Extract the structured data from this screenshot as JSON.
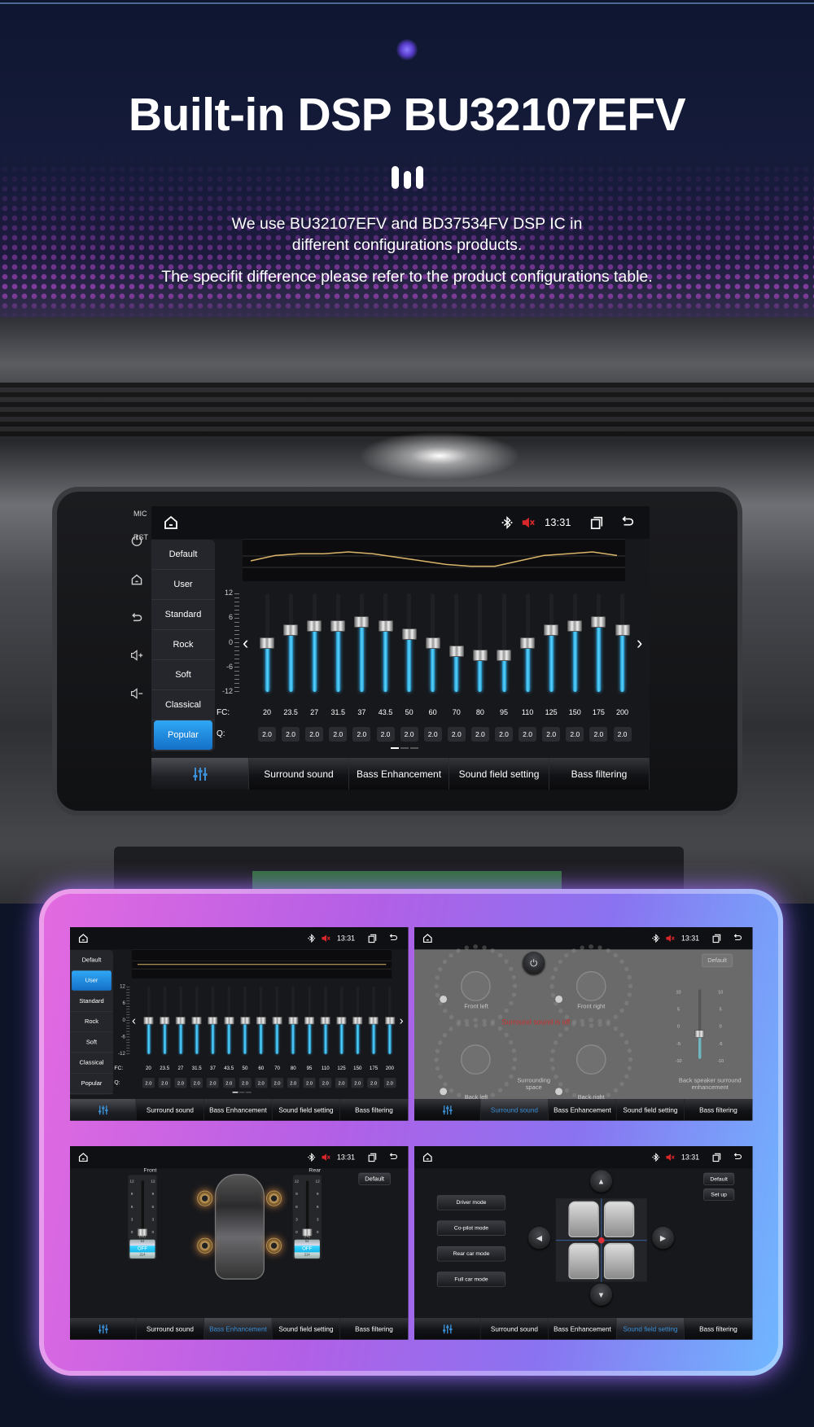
{
  "header": {
    "title": "Built-in DSP BU32107EFV",
    "line1": "We use BU32107EFV and BD37534FV DSP IC in",
    "line2": "different configurations products.",
    "line3": "The specifit difference please refer to the product configurations table."
  },
  "colors": {
    "accent_blue": "#2fa7f5",
    "slider_fill": "#59d6ff",
    "mute_red": "#d8262a",
    "curve": "#d9b56a",
    "active_tab": "#3a8fd6",
    "frame_left": "#e060e0",
    "frame_right": "#5fb0ff"
  },
  "side_panel": {
    "mic": "MIC",
    "rst": "RST",
    "icons": [
      "power-icon",
      "home-icon",
      "back-icon",
      "volume-up-icon",
      "volume-down-icon"
    ]
  },
  "status_bar": {
    "time": "13:31",
    "icons": [
      "home-icon",
      "bluetooth-icon",
      "mute-icon",
      "recent-apps-icon",
      "back-icon"
    ]
  },
  "tabs": {
    "eq_icon": "equalizer-icon",
    "items": [
      "Surround sound",
      "Bass Enhancement",
      "Sound field setting",
      "Bass filtering"
    ]
  },
  "eq_main": {
    "presets": [
      "Default",
      "User",
      "Standard",
      "Rock",
      "Soft",
      "Classical",
      "Popular"
    ],
    "selected": "Popular",
    "y_ticks": [
      "12",
      "6",
      "0",
      "-6",
      "-12"
    ],
    "gain_range": [
      -12,
      12
    ],
    "fc_label": "FC:",
    "q_label": "Q:",
    "fc": [
      "20",
      "23.5",
      "27",
      "31.5",
      "37",
      "43.5",
      "50",
      "60",
      "70",
      "80",
      "95",
      "110",
      "125",
      "150",
      "175",
      "200"
    ],
    "q": [
      "2.0",
      "2.0",
      "2.0",
      "2.0",
      "2.0",
      "2.0",
      "2.0",
      "2.0",
      "2.0",
      "2.0",
      "2.0",
      "2.0",
      "2.0",
      "2.0",
      "2.0",
      "2.0"
    ],
    "gains": [
      0,
      3,
      4,
      4,
      5,
      4,
      2,
      0,
      -2,
      -3,
      -3,
      0,
      3,
      4,
      5,
      3
    ],
    "page": 1,
    "pages": 3
  },
  "eq_mini": {
    "presets": [
      "Default",
      "User",
      "Standard",
      "Rock",
      "Soft",
      "Classical",
      "Popular"
    ],
    "selected": "User",
    "y_ticks": [
      "12",
      "6",
      "0",
      "-6",
      "-12"
    ],
    "fc_label": "FC:",
    "q_label": "Q:",
    "fc": [
      "20",
      "23.5",
      "27",
      "31.5",
      "37",
      "43.5",
      "50",
      "60",
      "70",
      "80",
      "95",
      "110",
      "125",
      "150",
      "175",
      "200"
    ],
    "q": [
      "2.0",
      "2.0",
      "2.0",
      "2.0",
      "2.0",
      "2.0",
      "2.0",
      "2.0",
      "2.0",
      "2.0",
      "2.0",
      "2.0",
      "2.0",
      "2.0",
      "2.0",
      "2.0"
    ],
    "gains": [
      0,
      0,
      0,
      0,
      0,
      0,
      0,
      0,
      0,
      0,
      0,
      0,
      0,
      0,
      0,
      0
    ],
    "page": 1,
    "pages": 3
  },
  "surround": {
    "active_tab": "Surround sound",
    "default_label": "Default",
    "front_left": "Front left",
    "front_right": "Front right",
    "back_left": "Back left",
    "back_right": "Back right",
    "space": "Surrounding space",
    "back_speaker": "Back speaker surround enhancement",
    "off_message": "Surround sound is off",
    "ticks": [
      "10",
      "5",
      "0",
      "-5",
      "-10"
    ],
    "level": -3
  },
  "bass": {
    "active_tab": "Bass Enhancement",
    "default_label": "Default",
    "channels": [
      {
        "label": "Front",
        "ticks": [
          "12",
          "9",
          "6",
          "3",
          "0"
        ],
        "unit": "(Hz)",
        "freq_above": "54",
        "freq_value": "OFF",
        "freq_below": "214",
        "level": 0
      },
      {
        "label": "Rear",
        "ticks": [
          "12",
          "9",
          "6",
          "3",
          "0"
        ],
        "unit": "(Hz)",
        "freq_above": "54",
        "freq_value": "OFF",
        "freq_below": "214",
        "level": 0
      }
    ]
  },
  "sound_field": {
    "active_tab": "Sound field setting",
    "modes": [
      "Driver mode",
      "Co-pilot mode",
      "Rear car mode",
      "Full car mode"
    ],
    "default_label": "Default",
    "setup_label": "Set up"
  }
}
